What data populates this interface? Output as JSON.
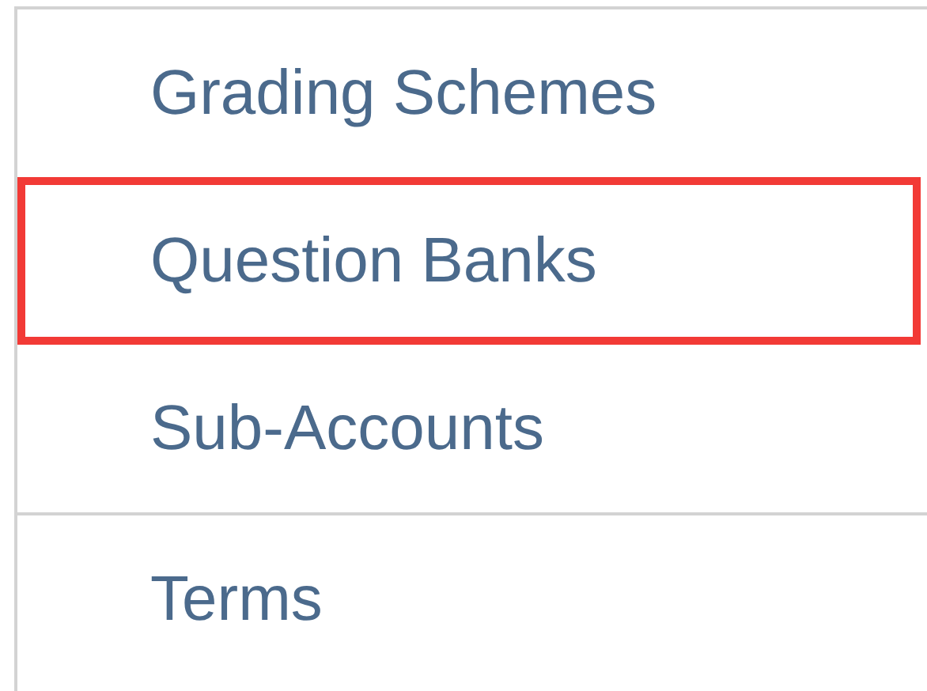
{
  "menu": {
    "groups": [
      {
        "items": [
          {
            "label": "Grading Schemes",
            "highlighted": false
          },
          {
            "label": "Question Banks",
            "highlighted": true
          },
          {
            "label": "Sub-Accounts",
            "highlighted": false
          }
        ]
      },
      {
        "items": [
          {
            "label": "Terms",
            "highlighted": false
          }
        ]
      }
    ]
  }
}
